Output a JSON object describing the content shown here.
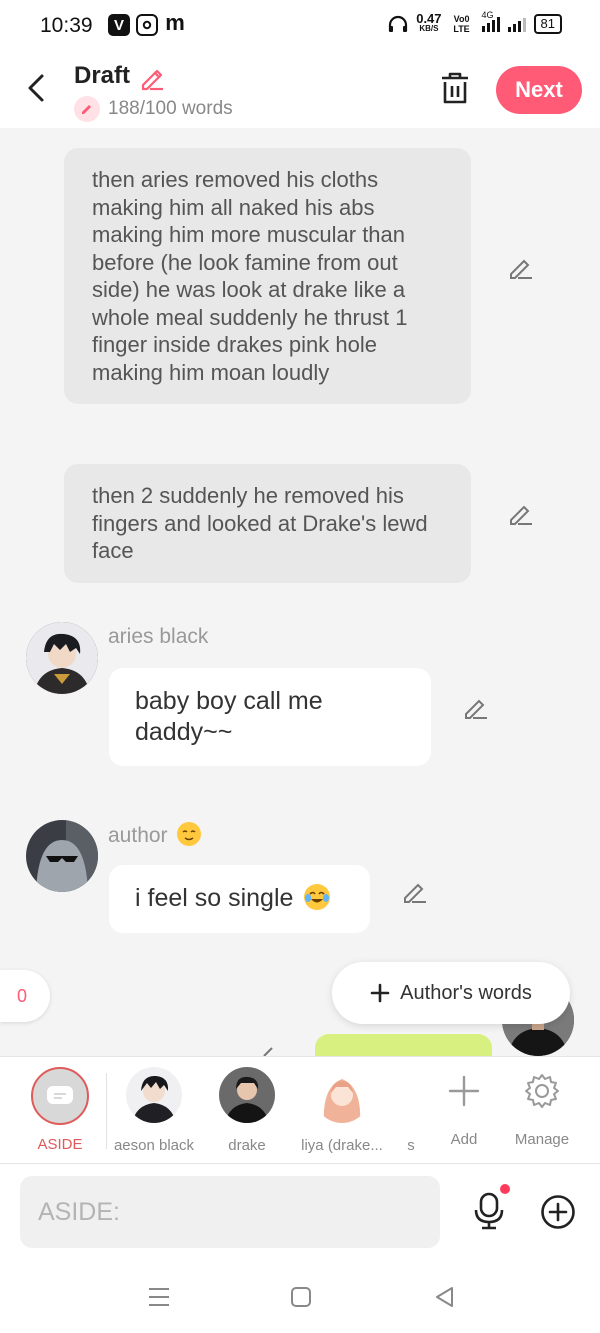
{
  "status_bar": {
    "time": "10:39",
    "apps": [
      "V",
      "ig",
      "m"
    ],
    "net_speed": "0.47",
    "net_unit": "KB/S",
    "net_type": "Vo0 LTE",
    "net_gen": "4G",
    "battery": "81"
  },
  "header": {
    "title": "Draft",
    "word_count": "188/100 words",
    "next_label": "Next",
    "accent_color": "#ff5a76"
  },
  "messages": {
    "narration_1": "then aries removed his cloths making him all naked his abs making him more muscular than before (he look famine from out side) he was look at drake like a whole meal suddenly he thrust 1 finger inside drakes pink hole making him moan loudly",
    "narration_2": "then 2 suddenly he removed his fingers and looked at Drake's lewd face",
    "msg_1": {
      "name": "aries black",
      "text": "baby boy call me daddy~~"
    },
    "msg_2": {
      "name": "author",
      "text": "i feel so single"
    }
  },
  "floating": {
    "count": "0",
    "authors_words": "Author's words"
  },
  "characters": [
    {
      "label": "ASIDE"
    },
    {
      "label": "aeson black"
    },
    {
      "label": "drake"
    },
    {
      "label": "liya (drake..."
    },
    {
      "label": "s"
    }
  ],
  "actions": {
    "add_label": "Add",
    "manage_label": "Manage"
  },
  "input": {
    "placeholder": "ASIDE:"
  }
}
